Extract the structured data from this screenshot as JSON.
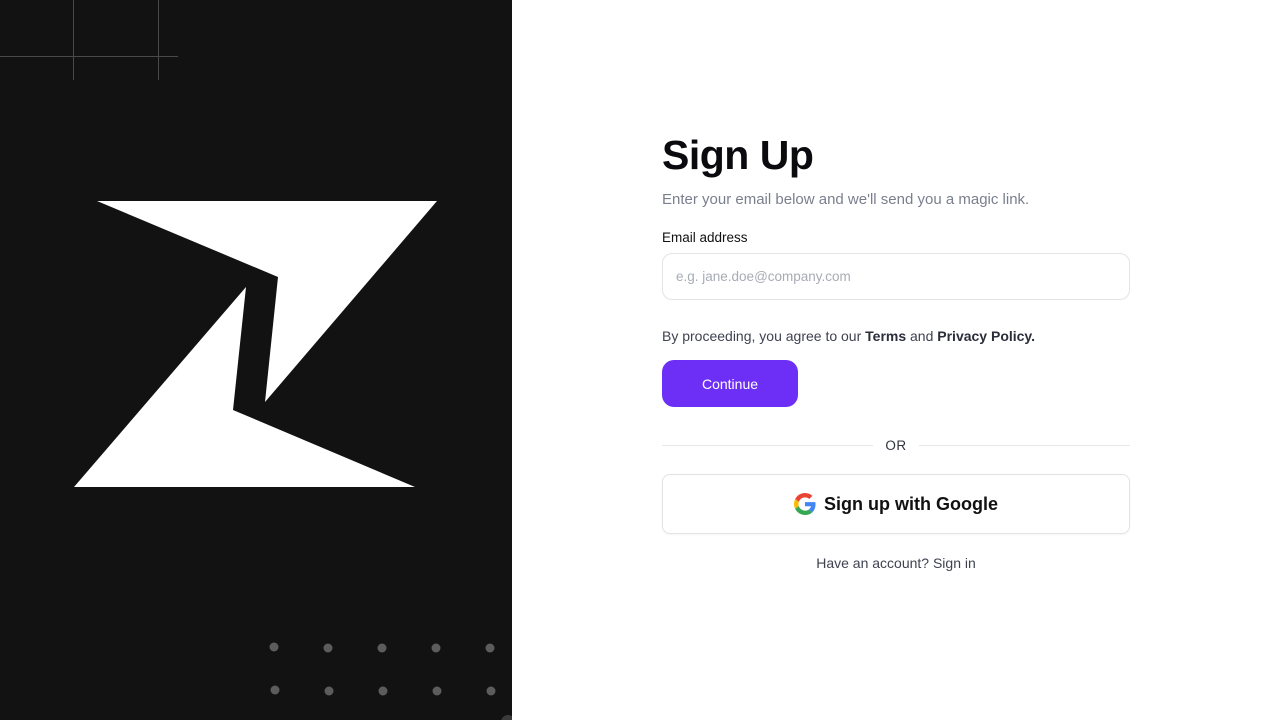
{
  "brand": {
    "logo_icon": "zigzag-logo-icon",
    "panel_color": "#121212"
  },
  "signup": {
    "title": "Sign Up",
    "subtitle": "Enter your email below and we'll send you a magic link.",
    "email": {
      "label": "Email address",
      "placeholder": "e.g. jane.doe@company.com",
      "value": ""
    },
    "terms": {
      "prefix": "By proceeding, you agree to our ",
      "terms_link": "Terms",
      "joiner": " and ",
      "privacy_link": "Privacy Policy."
    },
    "continue_label": "Continue",
    "divider_text": "OR",
    "google": {
      "icon": "google-g-icon",
      "label": "Sign up with Google"
    },
    "signin_text": "Have an account? Sign in"
  },
  "colors": {
    "accent": "#6d2ff5",
    "panel": "#121212",
    "muted_text": "#7a7f8e"
  }
}
